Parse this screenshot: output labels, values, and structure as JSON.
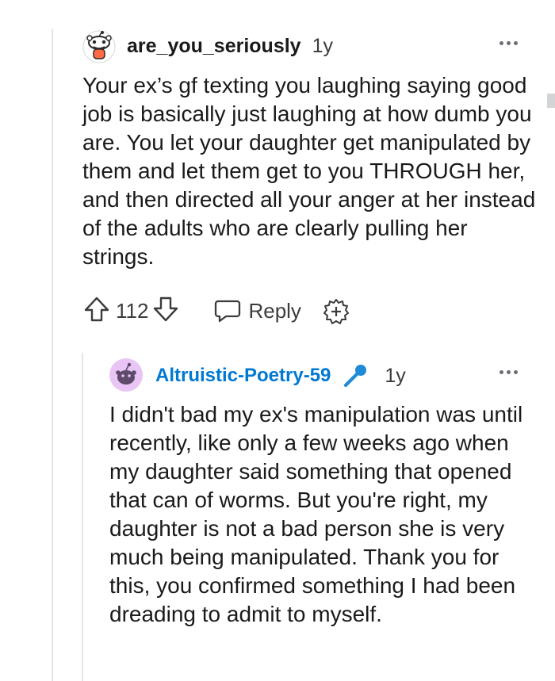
{
  "comment": {
    "username": "are_you_seriously",
    "age": "1y",
    "text": "Your ex’s gf texting you laughing saying good job is basically just laughing at how dumb you are. You let your daughter get manipulated by them and let them get to you THROUGH her, and then directed all your anger at her instead of the adults who are clearly pulling her strings.",
    "votes": "112",
    "reply_label": "Reply",
    "icons": [
      "avatar-snoo",
      "more-options",
      "upvote-arrow",
      "downvote-arrow",
      "reply-bubble",
      "award-plus"
    ]
  },
  "reply": {
    "username": "Altruistic-Poetry-59",
    "age": "1y",
    "flair_icon": "microphone",
    "text": "I didn't bad my ex's manipulation was until recently, like only a few weeks ago when my daughter said something that opened that can of worms. But you're right, my daughter is not a bad person she is very much being manipulated. Thank you for this, you confirmed something I had been dreading to admit to myself.",
    "username_color": "#0079d3"
  }
}
